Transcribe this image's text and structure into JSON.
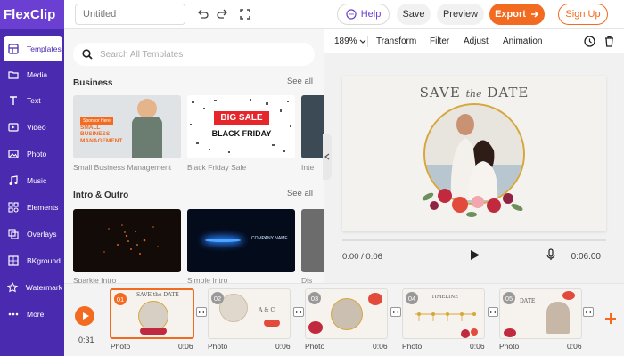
{
  "app": {
    "logo_text": "FlexClip"
  },
  "header": {
    "title_placeholder": "Untitled",
    "help_label": "Help",
    "save_label": "Save",
    "preview_label": "Preview",
    "export_label": "Export",
    "signup_label": "Sign Up"
  },
  "sidebar": {
    "items": [
      {
        "label": "Templates",
        "icon": "templates-icon",
        "active": true
      },
      {
        "label": "Media",
        "icon": "media-icon"
      },
      {
        "label": "Text",
        "icon": "text-icon"
      },
      {
        "label": "Video",
        "icon": "video-icon"
      },
      {
        "label": "Photo",
        "icon": "photo-icon"
      },
      {
        "label": "Music",
        "icon": "music-icon"
      },
      {
        "label": "Elements",
        "icon": "elements-icon"
      },
      {
        "label": "Overlays",
        "icon": "overlays-icon"
      },
      {
        "label": "BKground",
        "icon": "background-icon"
      },
      {
        "label": "Watermark",
        "icon": "watermark-icon"
      },
      {
        "label": "More",
        "icon": "more-icon"
      }
    ]
  },
  "templates": {
    "search_placeholder": "Search All Templates",
    "sections": [
      {
        "title": "Business",
        "see_all": "See all",
        "items": [
          {
            "caption": "Small Business Management",
            "thumb_text_1": "Sponsor Here",
            "thumb_text_2": "SMALL BUSINESS MANAGEMENT"
          },
          {
            "caption": "Black Friday Sale",
            "thumb_text_1": "BIG SALE",
            "thumb_text_2": "BLACK FRIDAY"
          },
          {
            "caption": "Inte"
          }
        ]
      },
      {
        "title": "Intro & Outro",
        "see_all": "See all",
        "items": [
          {
            "caption": "Sparkle Intro",
            "thumb_text_1": ""
          },
          {
            "caption": "Simple Intro",
            "thumb_text_1": "COMPANY NAME"
          },
          {
            "caption": "Dis"
          }
        ]
      }
    ]
  },
  "editor": {
    "zoom": "189%",
    "tools": [
      "Transform",
      "Filter",
      "Adjust",
      "Animation"
    ],
    "canvas": {
      "title_left": "SAVE",
      "title_script": "the",
      "title_right": "DATE"
    },
    "current_time": "0:00 / 0:06",
    "duration": "0:06.00"
  },
  "timeline": {
    "total_time": "0:31",
    "clips": [
      {
        "num": "01",
        "label": "Photo",
        "duration": "0:06",
        "active": true,
        "title": "SAVE the DATE"
      },
      {
        "num": "02",
        "label": "Photo",
        "duration": "0:06",
        "title": "A & C"
      },
      {
        "num": "03",
        "label": "Photo",
        "duration": "0:06",
        "title": ""
      },
      {
        "num": "04",
        "label": "Photo",
        "duration": "0:06",
        "title": "TIMELINE"
      },
      {
        "num": "05",
        "label": "Photo",
        "duration": "0:06",
        "title": "DATE"
      }
    ]
  },
  "colors": {
    "brand": "#6a3fd1",
    "sidebar": "#4a2bb0",
    "accent": "#f26b21"
  }
}
